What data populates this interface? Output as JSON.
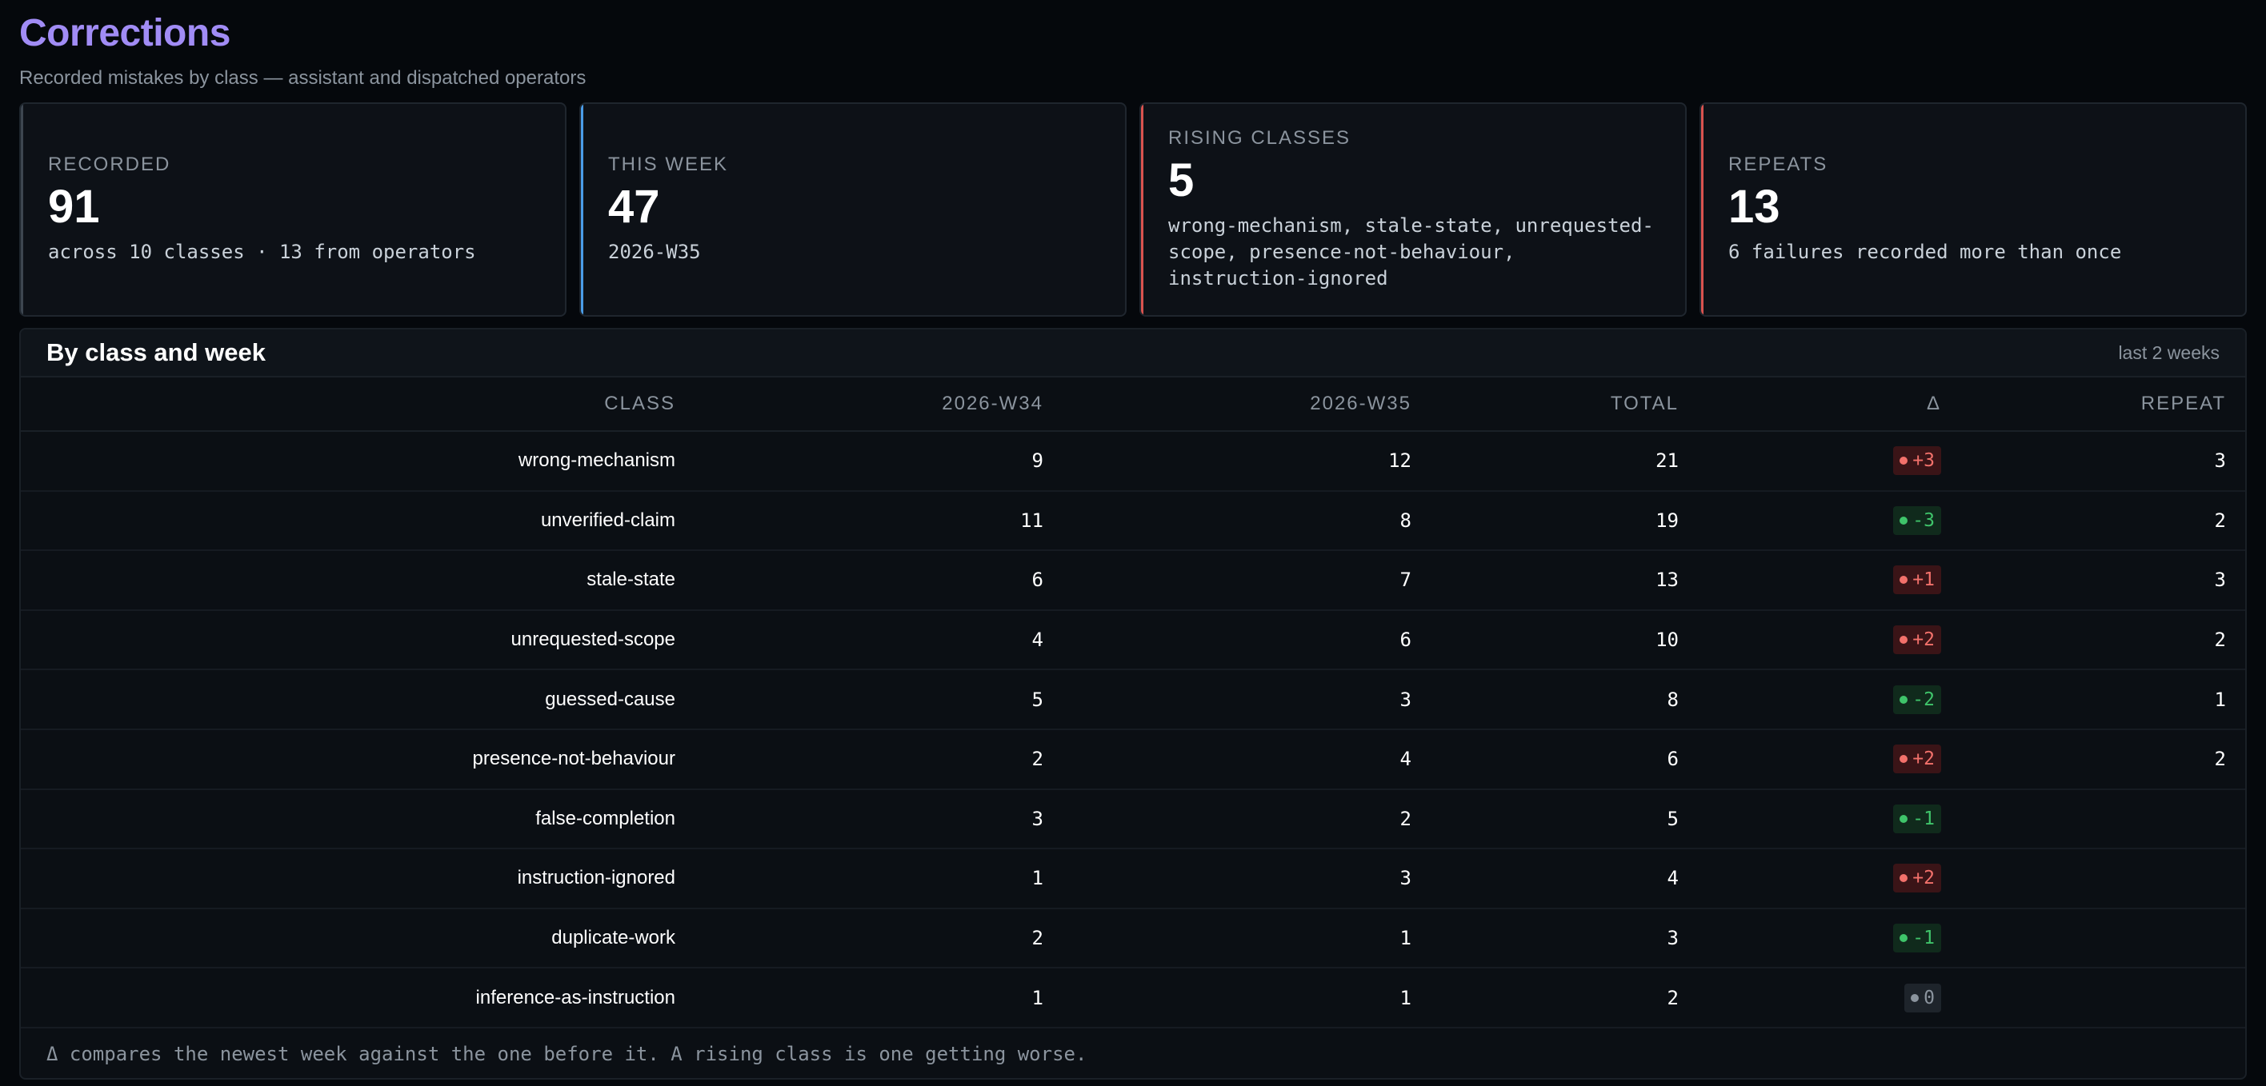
{
  "header": {
    "title": "Corrections",
    "subtitle": "Recorded mistakes by class — assistant and dispatched operators"
  },
  "cards": [
    {
      "label": "RECORDED",
      "value": "91",
      "sub": "across 10 classes · 13 from operators",
      "accent": "#3d4650"
    },
    {
      "label": "THIS WEEK",
      "value": "47",
      "sub": "2026-W35",
      "accent": "#4a9de8"
    },
    {
      "label": "RISING CLASSES",
      "value": "5",
      "sub": "wrong-mechanism, stale-state, unrequested-\nscope, presence-not-behaviour,\ninstruction-ignored",
      "accent": "#d9534f"
    },
    {
      "label": "REPEATS",
      "value": "13",
      "sub": "6 failures recorded more than once",
      "accent": "#d9534f"
    }
  ],
  "panel": {
    "title": "By class and week",
    "range": "last 2 weeks",
    "columns": [
      "CLASS",
      "2026-W34",
      "2026-W35",
      "TOTAL",
      "Δ",
      "REPEAT"
    ],
    "rows": [
      {
        "cls": "wrong-mechanism",
        "w34": "9",
        "w35": "12",
        "total": "21",
        "delta": "+3",
        "trend": "up",
        "repeat": "3"
      },
      {
        "cls": "unverified-claim",
        "w34": "11",
        "w35": "8",
        "total": "19",
        "delta": "-3",
        "trend": "down",
        "repeat": "2"
      },
      {
        "cls": "stale-state",
        "w34": "6",
        "w35": "7",
        "total": "13",
        "delta": "+1",
        "trend": "up",
        "repeat": "3"
      },
      {
        "cls": "unrequested-scope",
        "w34": "4",
        "w35": "6",
        "total": "10",
        "delta": "+2",
        "trend": "up",
        "repeat": "2"
      },
      {
        "cls": "guessed-cause",
        "w34": "5",
        "w35": "3",
        "total": "8",
        "delta": "-2",
        "trend": "down",
        "repeat": "1"
      },
      {
        "cls": "presence-not-behaviour",
        "w34": "2",
        "w35": "4",
        "total": "6",
        "delta": "+2",
        "trend": "up",
        "repeat": "2"
      },
      {
        "cls": "false-completion",
        "w34": "3",
        "w35": "2",
        "total": "5",
        "delta": "-1",
        "trend": "down",
        "repeat": ""
      },
      {
        "cls": "instruction-ignored",
        "w34": "1",
        "w35": "3",
        "total": "4",
        "delta": "+2",
        "trend": "up",
        "repeat": ""
      },
      {
        "cls": "duplicate-work",
        "w34": "2",
        "w35": "1",
        "total": "3",
        "delta": "-1",
        "trend": "down",
        "repeat": ""
      },
      {
        "cls": "inference-as-instruction",
        "w34": "1",
        "w35": "1",
        "total": "2",
        "delta": "0",
        "trend": "flat",
        "repeat": ""
      }
    ],
    "footnote": "Δ compares the newest week against the one before it. A rising class is one getting worse."
  },
  "colors": {
    "title": "#a18cf5",
    "rising": "#f2716b",
    "falling": "#3fc46a",
    "neutral": "#8b949e"
  }
}
